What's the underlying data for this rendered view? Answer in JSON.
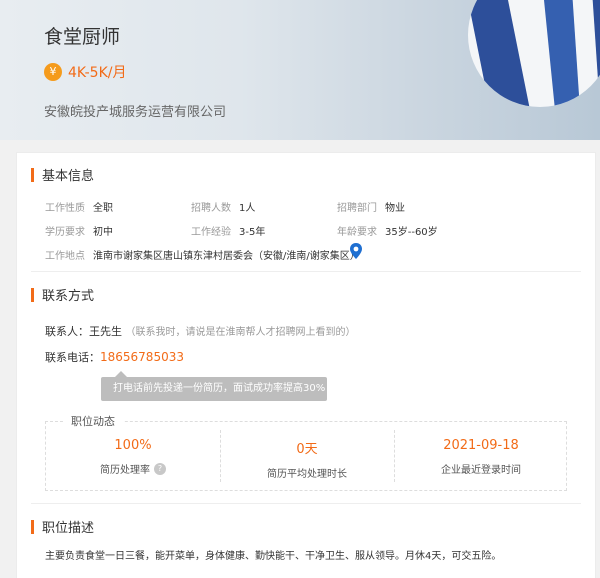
{
  "header": {
    "job_title": "食堂厨师",
    "salary_icon": "¥",
    "salary": "4K-5K/月",
    "company": "安徽皖投产城服务运营有限公司"
  },
  "basic_info": {
    "section_title": "基本信息",
    "fields": [
      {
        "label": "工作性质",
        "value": "全职"
      },
      {
        "label": "招聘人数",
        "value": "1人"
      },
      {
        "label": "招聘部门",
        "value": "物业"
      },
      {
        "label": "学历要求",
        "value": "初中"
      },
      {
        "label": "工作经验",
        "value": "3-5年"
      },
      {
        "label": "年龄要求",
        "value": "35岁--60岁"
      }
    ],
    "location_label": "工作地点",
    "location_value": "淮南市谢家集区唐山镇东津村居委会（安徽/淮南/谢家集区）"
  },
  "contact": {
    "section_title": "联系方式",
    "person_label": "联系人：",
    "person_name": "王先生",
    "person_hint": "（联系我时，请说是在淮南帮人才招聘网上看到的）",
    "phone_label": "联系电话：",
    "phone_number": "18656785033",
    "tooltip": "打电话前先投递一份简历，面试成功率提高30%"
  },
  "dynamics": {
    "title": "职位动态",
    "items": [
      {
        "value": "100%",
        "label": "简历处理率"
      },
      {
        "value": "0天",
        "label": "简历平均处理时长"
      },
      {
        "value": "2021-09-18",
        "label": "企业最近登录时间"
      }
    ],
    "help_icon": "?"
  },
  "description": {
    "section_title": "职位描述",
    "text": "主要负责食堂一日三餐，能开菜单，身体健康、勤快能干、干净卫生、服从领导。月休4天，可交五险。"
  },
  "colors": {
    "accent": "#f26b18",
    "coin": "#f59b1c",
    "location": "#1f6fd1"
  }
}
